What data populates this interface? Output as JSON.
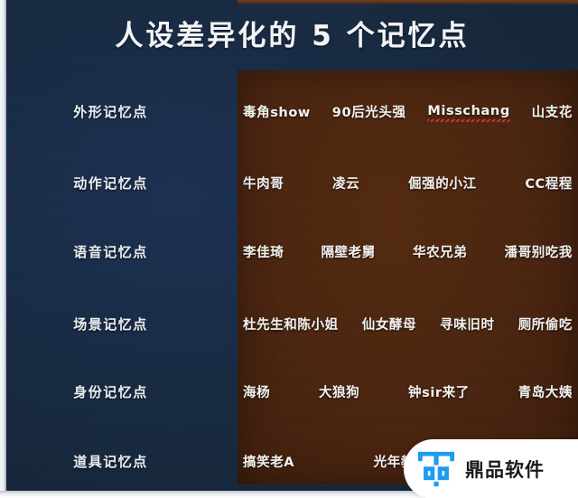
{
  "slide": {
    "title": "人设差异化的 5 个记忆点",
    "background_color": "#17293f",
    "panel_color": "#49240f"
  },
  "rows": [
    {
      "label": "外形记忆点",
      "items": [
        "毒角show",
        "90后光头强",
        "Misschang",
        "山支花"
      ],
      "misspelled_index": 2
    },
    {
      "label": "动作记忆点",
      "items": [
        "牛肉哥",
        "凌云",
        "倔强的小江",
        "CC程程"
      ],
      "misspelled_index": -1
    },
    {
      "label": "语音记忆点",
      "items": [
        "李佳琦",
        "隔壁老舅",
        "华农兄弟",
        "潘哥别吃我"
      ],
      "misspelled_index": -1
    },
    {
      "label": "场景记忆点",
      "items": [
        "杜先生和陈小姐",
        "仙女酵母",
        "寻味旧时",
        "厕所偷吃"
      ],
      "misspelled_index": -1
    },
    {
      "label": "身份记忆点",
      "items": [
        "海杨",
        "大狼狗",
        "钟sir来了",
        "青岛大姨"
      ],
      "misspelled_index": -1
    },
    {
      "label": "道具记忆点",
      "items": [
        "搞笑老A",
        "光年教",
        "",
        ""
      ],
      "misspelled_index": -1
    }
  ],
  "watermark": {
    "text": "鼎品软件",
    "logo_color": "#1e9cf0",
    "logo_name": "ding-logo-icon"
  }
}
